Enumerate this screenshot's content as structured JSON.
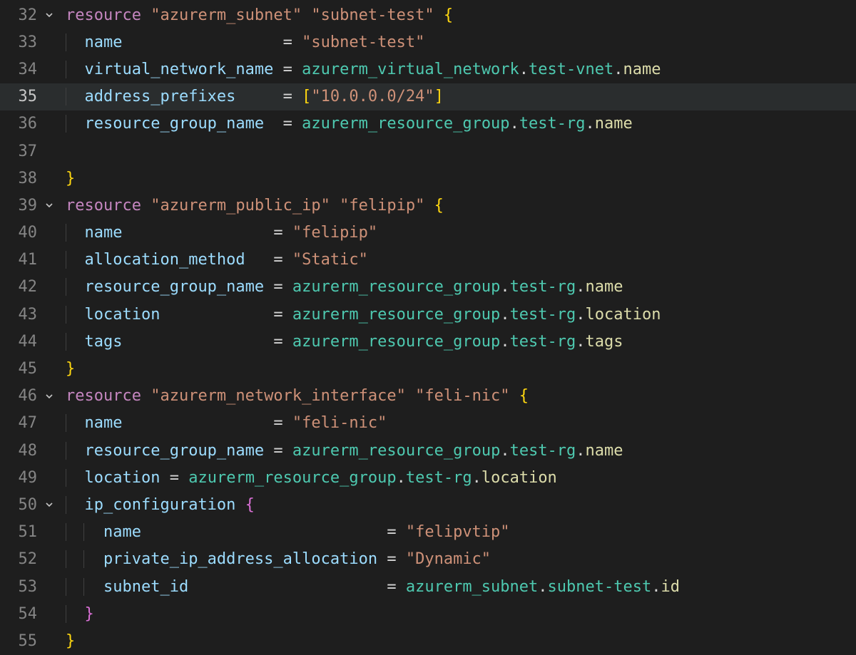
{
  "colors": {
    "background": "#1e1e1e",
    "highlight_line_bg": "#2a2d2e",
    "keyword": "#c586c0",
    "string": "#ce9178",
    "property": "#9cdcfe",
    "type": "#4ec9b0",
    "member": "#dcdcaa",
    "bracket_outer": "#ffd710",
    "bracket_inner": "#da70d6",
    "gutter": "#858585",
    "gutter_active": "#c6c6c6"
  },
  "language": "terraform",
  "active_line": 35,
  "lines": [
    {
      "num": "32",
      "fold": true,
      "guides": 0,
      "tokens": [
        [
          "kw",
          "resource"
        ],
        [
          "pun",
          " "
        ],
        [
          "str",
          "\"azurerm_subnet\""
        ],
        [
          "pun",
          " "
        ],
        [
          "str",
          "\"subnet-test\""
        ],
        [
          "pun",
          " "
        ],
        [
          "br",
          "{"
        ]
      ]
    },
    {
      "num": "33",
      "fold": false,
      "guides": 1,
      "tokens": [
        [
          "pun",
          "  "
        ],
        [
          "prop",
          "name"
        ],
        [
          "pun",
          "                 = "
        ],
        [
          "str",
          "\"subnet-test\""
        ]
      ]
    },
    {
      "num": "34",
      "fold": false,
      "guides": 1,
      "tokens": [
        [
          "pun",
          "  "
        ],
        [
          "prop",
          "virtual_network_name"
        ],
        [
          "pun",
          " = "
        ],
        [
          "obj",
          "azurerm_virtual_network"
        ],
        [
          "pun",
          "."
        ],
        [
          "obj",
          "test-vnet"
        ],
        [
          "pun",
          "."
        ],
        [
          "mem",
          "name"
        ]
      ]
    },
    {
      "num": "35",
      "fold": false,
      "guides": 1,
      "hl": true,
      "tokens": [
        [
          "pun",
          "  "
        ],
        [
          "prop",
          "address_prefixes"
        ],
        [
          "pun",
          "     = "
        ],
        [
          "br",
          "["
        ],
        [
          "str",
          "\"10.0.0.0/24\""
        ],
        [
          "br",
          "]"
        ]
      ]
    },
    {
      "num": "36",
      "fold": false,
      "guides": 1,
      "tokens": [
        [
          "pun",
          "  "
        ],
        [
          "prop",
          "resource_group_name"
        ],
        [
          "pun",
          "  = "
        ],
        [
          "obj",
          "azurerm_resource_group"
        ],
        [
          "pun",
          "."
        ],
        [
          "obj",
          "test-rg"
        ],
        [
          "pun",
          "."
        ],
        [
          "mem",
          "name"
        ]
      ]
    },
    {
      "num": "37",
      "fold": false,
      "guides": 1,
      "tokens": []
    },
    {
      "num": "38",
      "fold": false,
      "guides": 0,
      "tokens": [
        [
          "br",
          "}"
        ]
      ]
    },
    {
      "num": "39",
      "fold": true,
      "guides": 0,
      "tokens": [
        [
          "kw",
          "resource"
        ],
        [
          "pun",
          " "
        ],
        [
          "str",
          "\"azurerm_public_ip\""
        ],
        [
          "pun",
          " "
        ],
        [
          "str",
          "\"felipip\""
        ],
        [
          "pun",
          " "
        ],
        [
          "br",
          "{"
        ]
      ]
    },
    {
      "num": "40",
      "fold": false,
      "guides": 1,
      "tokens": [
        [
          "pun",
          "  "
        ],
        [
          "prop",
          "name"
        ],
        [
          "pun",
          "                = "
        ],
        [
          "str",
          "\"felipip\""
        ]
      ]
    },
    {
      "num": "41",
      "fold": false,
      "guides": 1,
      "tokens": [
        [
          "pun",
          "  "
        ],
        [
          "prop",
          "allocation_method"
        ],
        [
          "pun",
          "   = "
        ],
        [
          "str",
          "\"Static\""
        ]
      ]
    },
    {
      "num": "42",
      "fold": false,
      "guides": 1,
      "tokens": [
        [
          "pun",
          "  "
        ],
        [
          "prop",
          "resource_group_name"
        ],
        [
          "pun",
          " = "
        ],
        [
          "obj",
          "azurerm_resource_group"
        ],
        [
          "pun",
          "."
        ],
        [
          "obj",
          "test-rg"
        ],
        [
          "pun",
          "."
        ],
        [
          "mem",
          "name"
        ]
      ]
    },
    {
      "num": "43",
      "fold": false,
      "guides": 1,
      "tokens": [
        [
          "pun",
          "  "
        ],
        [
          "prop",
          "location"
        ],
        [
          "pun",
          "            = "
        ],
        [
          "obj",
          "azurerm_resource_group"
        ],
        [
          "pun",
          "."
        ],
        [
          "obj",
          "test-rg"
        ],
        [
          "pun",
          "."
        ],
        [
          "mem",
          "location"
        ]
      ]
    },
    {
      "num": "44",
      "fold": false,
      "guides": 1,
      "tokens": [
        [
          "pun",
          "  "
        ],
        [
          "prop",
          "tags"
        ],
        [
          "pun",
          "                = "
        ],
        [
          "obj",
          "azurerm_resource_group"
        ],
        [
          "pun",
          "."
        ],
        [
          "obj",
          "test-rg"
        ],
        [
          "pun",
          "."
        ],
        [
          "mem",
          "tags"
        ]
      ]
    },
    {
      "num": "45",
      "fold": false,
      "guides": 0,
      "tokens": [
        [
          "br",
          "}"
        ]
      ]
    },
    {
      "num": "46",
      "fold": true,
      "guides": 0,
      "tokens": [
        [
          "kw",
          "resource"
        ],
        [
          "pun",
          " "
        ],
        [
          "str",
          "\"azurerm_network_interface\""
        ],
        [
          "pun",
          " "
        ],
        [
          "str",
          "\"feli-nic\""
        ],
        [
          "pun",
          " "
        ],
        [
          "br",
          "{"
        ]
      ]
    },
    {
      "num": "47",
      "fold": false,
      "guides": 1,
      "tokens": [
        [
          "pun",
          "  "
        ],
        [
          "prop",
          "name"
        ],
        [
          "pun",
          "                = "
        ],
        [
          "str",
          "\"feli-nic\""
        ]
      ]
    },
    {
      "num": "48",
      "fold": false,
      "guides": 1,
      "tokens": [
        [
          "pun",
          "  "
        ],
        [
          "prop",
          "resource_group_name"
        ],
        [
          "pun",
          " = "
        ],
        [
          "obj",
          "azurerm_resource_group"
        ],
        [
          "pun",
          "."
        ],
        [
          "obj",
          "test-rg"
        ],
        [
          "pun",
          "."
        ],
        [
          "mem",
          "name"
        ]
      ]
    },
    {
      "num": "49",
      "fold": false,
      "guides": 1,
      "tokens": [
        [
          "pun",
          "  "
        ],
        [
          "prop",
          "location"
        ],
        [
          "pun",
          " = "
        ],
        [
          "obj",
          "azurerm_resource_group"
        ],
        [
          "pun",
          "."
        ],
        [
          "obj",
          "test-rg"
        ],
        [
          "pun",
          "."
        ],
        [
          "mem",
          "location"
        ]
      ]
    },
    {
      "num": "50",
      "fold": true,
      "guides": 1,
      "tokens": [
        [
          "pun",
          "  "
        ],
        [
          "prop",
          "ip_configuration"
        ],
        [
          "pun",
          " "
        ],
        [
          "br2",
          "{"
        ]
      ]
    },
    {
      "num": "51",
      "fold": false,
      "guides": 2,
      "tokens": [
        [
          "pun",
          "    "
        ],
        [
          "prop",
          "name"
        ],
        [
          "pun",
          "                          = "
        ],
        [
          "str",
          "\"felipvtip\""
        ]
      ]
    },
    {
      "num": "52",
      "fold": false,
      "guides": 2,
      "tokens": [
        [
          "pun",
          "    "
        ],
        [
          "prop",
          "private_ip_address_allocation"
        ],
        [
          "pun",
          " = "
        ],
        [
          "str",
          "\"Dynamic\""
        ]
      ]
    },
    {
      "num": "53",
      "fold": false,
      "guides": 2,
      "tokens": [
        [
          "pun",
          "    "
        ],
        [
          "prop",
          "subnet_id"
        ],
        [
          "pun",
          "                     = "
        ],
        [
          "obj",
          "azurerm_subnet"
        ],
        [
          "pun",
          "."
        ],
        [
          "obj",
          "subnet-test"
        ],
        [
          "pun",
          "."
        ],
        [
          "mem",
          "id"
        ]
      ]
    },
    {
      "num": "54",
      "fold": false,
      "guides": 1,
      "tokens": [
        [
          "pun",
          "  "
        ],
        [
          "br2",
          "}"
        ]
      ]
    },
    {
      "num": "55",
      "fold": false,
      "guides": 0,
      "tokens": [
        [
          "br",
          "}"
        ]
      ]
    }
  ]
}
